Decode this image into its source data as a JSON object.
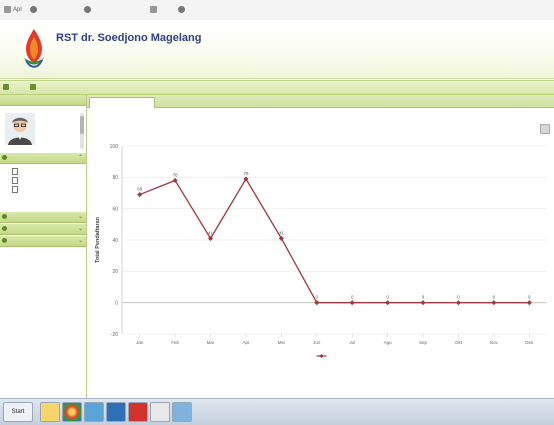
{
  "browser": {
    "bookmarks": [
      "Apl",
      "",
      "",
      "",
      "",
      ""
    ]
  },
  "header": {
    "hospital_name": "RST dr. Soedjono Magelang",
    "hospital_subtitle": ""
  },
  "toolbar": {
    "welcome_text": ""
  },
  "sidebar": {
    "panel_title": "",
    "profile": {
      "line1": "",
      "line2": ""
    },
    "menus": [
      {
        "label": "",
        "expanded": true,
        "items": [
          "",
          "",
          ""
        ]
      },
      {
        "label": "",
        "expanded": false
      },
      {
        "label": "",
        "expanded": false
      },
      {
        "label": "",
        "expanded": false
      }
    ]
  },
  "main": {
    "active_tab": ""
  },
  "chart_data": {
    "type": "line",
    "title": "",
    "subtitle": "",
    "ylabel": "Total Pendaftaran",
    "xlabel": "",
    "ylim": [
      -20,
      100
    ],
    "yticks": [
      100,
      80,
      60,
      40,
      20,
      0,
      -20
    ],
    "categories": [
      "Jan",
      "Feb",
      "Mar",
      "Apr",
      "Mei",
      "Jun",
      "Jul",
      "Agu",
      "Sep",
      "Okt",
      "Nov",
      "Des"
    ],
    "series": [
      {
        "name": "",
        "color": "#a0393d",
        "values": [
          69,
          78,
          41,
          79,
          41,
          0,
          0,
          0,
          0,
          0,
          0,
          0
        ]
      }
    ],
    "legend_position": "bottom",
    "grid": true
  },
  "taskbar": {
    "start_label": "Start",
    "tray_text": ""
  }
}
